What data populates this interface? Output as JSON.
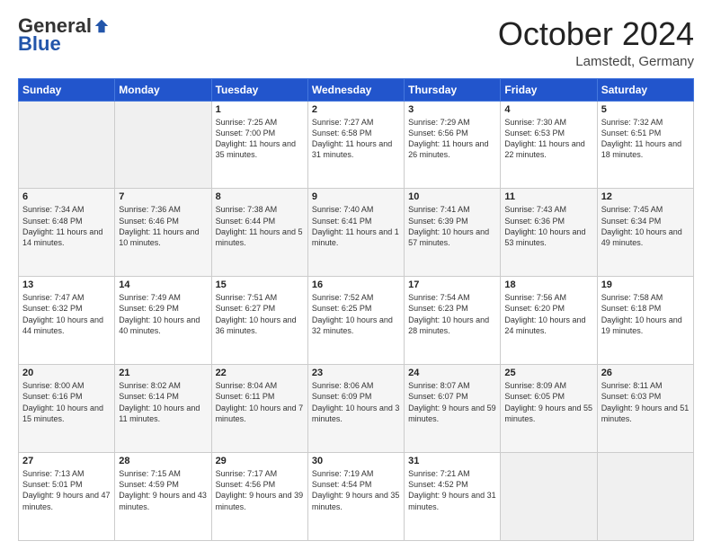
{
  "header": {
    "logo_general": "General",
    "logo_blue": "Blue",
    "month": "October 2024",
    "location": "Lamstedt, Germany"
  },
  "weekdays": [
    "Sunday",
    "Monday",
    "Tuesday",
    "Wednesday",
    "Thursday",
    "Friday",
    "Saturday"
  ],
  "weeks": [
    [
      {
        "day": "",
        "info": ""
      },
      {
        "day": "",
        "info": ""
      },
      {
        "day": "1",
        "info": "Sunrise: 7:25 AM\nSunset: 7:00 PM\nDaylight: 11 hours and 35 minutes."
      },
      {
        "day": "2",
        "info": "Sunrise: 7:27 AM\nSunset: 6:58 PM\nDaylight: 11 hours and 31 minutes."
      },
      {
        "day": "3",
        "info": "Sunrise: 7:29 AM\nSunset: 6:56 PM\nDaylight: 11 hours and 26 minutes."
      },
      {
        "day": "4",
        "info": "Sunrise: 7:30 AM\nSunset: 6:53 PM\nDaylight: 11 hours and 22 minutes."
      },
      {
        "day": "5",
        "info": "Sunrise: 7:32 AM\nSunset: 6:51 PM\nDaylight: 11 hours and 18 minutes."
      }
    ],
    [
      {
        "day": "6",
        "info": "Sunrise: 7:34 AM\nSunset: 6:48 PM\nDaylight: 11 hours and 14 minutes."
      },
      {
        "day": "7",
        "info": "Sunrise: 7:36 AM\nSunset: 6:46 PM\nDaylight: 11 hours and 10 minutes."
      },
      {
        "day": "8",
        "info": "Sunrise: 7:38 AM\nSunset: 6:44 PM\nDaylight: 11 hours and 5 minutes."
      },
      {
        "day": "9",
        "info": "Sunrise: 7:40 AM\nSunset: 6:41 PM\nDaylight: 11 hours and 1 minute."
      },
      {
        "day": "10",
        "info": "Sunrise: 7:41 AM\nSunset: 6:39 PM\nDaylight: 10 hours and 57 minutes."
      },
      {
        "day": "11",
        "info": "Sunrise: 7:43 AM\nSunset: 6:36 PM\nDaylight: 10 hours and 53 minutes."
      },
      {
        "day": "12",
        "info": "Sunrise: 7:45 AM\nSunset: 6:34 PM\nDaylight: 10 hours and 49 minutes."
      }
    ],
    [
      {
        "day": "13",
        "info": "Sunrise: 7:47 AM\nSunset: 6:32 PM\nDaylight: 10 hours and 44 minutes."
      },
      {
        "day": "14",
        "info": "Sunrise: 7:49 AM\nSunset: 6:29 PM\nDaylight: 10 hours and 40 minutes."
      },
      {
        "day": "15",
        "info": "Sunrise: 7:51 AM\nSunset: 6:27 PM\nDaylight: 10 hours and 36 minutes."
      },
      {
        "day": "16",
        "info": "Sunrise: 7:52 AM\nSunset: 6:25 PM\nDaylight: 10 hours and 32 minutes."
      },
      {
        "day": "17",
        "info": "Sunrise: 7:54 AM\nSunset: 6:23 PM\nDaylight: 10 hours and 28 minutes."
      },
      {
        "day": "18",
        "info": "Sunrise: 7:56 AM\nSunset: 6:20 PM\nDaylight: 10 hours and 24 minutes."
      },
      {
        "day": "19",
        "info": "Sunrise: 7:58 AM\nSunset: 6:18 PM\nDaylight: 10 hours and 19 minutes."
      }
    ],
    [
      {
        "day": "20",
        "info": "Sunrise: 8:00 AM\nSunset: 6:16 PM\nDaylight: 10 hours and 15 minutes."
      },
      {
        "day": "21",
        "info": "Sunrise: 8:02 AM\nSunset: 6:14 PM\nDaylight: 10 hours and 11 minutes."
      },
      {
        "day": "22",
        "info": "Sunrise: 8:04 AM\nSunset: 6:11 PM\nDaylight: 10 hours and 7 minutes."
      },
      {
        "day": "23",
        "info": "Sunrise: 8:06 AM\nSunset: 6:09 PM\nDaylight: 10 hours and 3 minutes."
      },
      {
        "day": "24",
        "info": "Sunrise: 8:07 AM\nSunset: 6:07 PM\nDaylight: 9 hours and 59 minutes."
      },
      {
        "day": "25",
        "info": "Sunrise: 8:09 AM\nSunset: 6:05 PM\nDaylight: 9 hours and 55 minutes."
      },
      {
        "day": "26",
        "info": "Sunrise: 8:11 AM\nSunset: 6:03 PM\nDaylight: 9 hours and 51 minutes."
      }
    ],
    [
      {
        "day": "27",
        "info": "Sunrise: 7:13 AM\nSunset: 5:01 PM\nDaylight: 9 hours and 47 minutes."
      },
      {
        "day": "28",
        "info": "Sunrise: 7:15 AM\nSunset: 4:59 PM\nDaylight: 9 hours and 43 minutes."
      },
      {
        "day": "29",
        "info": "Sunrise: 7:17 AM\nSunset: 4:56 PM\nDaylight: 9 hours and 39 minutes."
      },
      {
        "day": "30",
        "info": "Sunrise: 7:19 AM\nSunset: 4:54 PM\nDaylight: 9 hours and 35 minutes."
      },
      {
        "day": "31",
        "info": "Sunrise: 7:21 AM\nSunset: 4:52 PM\nDaylight: 9 hours and 31 minutes."
      },
      {
        "day": "",
        "info": ""
      },
      {
        "day": "",
        "info": ""
      }
    ]
  ]
}
